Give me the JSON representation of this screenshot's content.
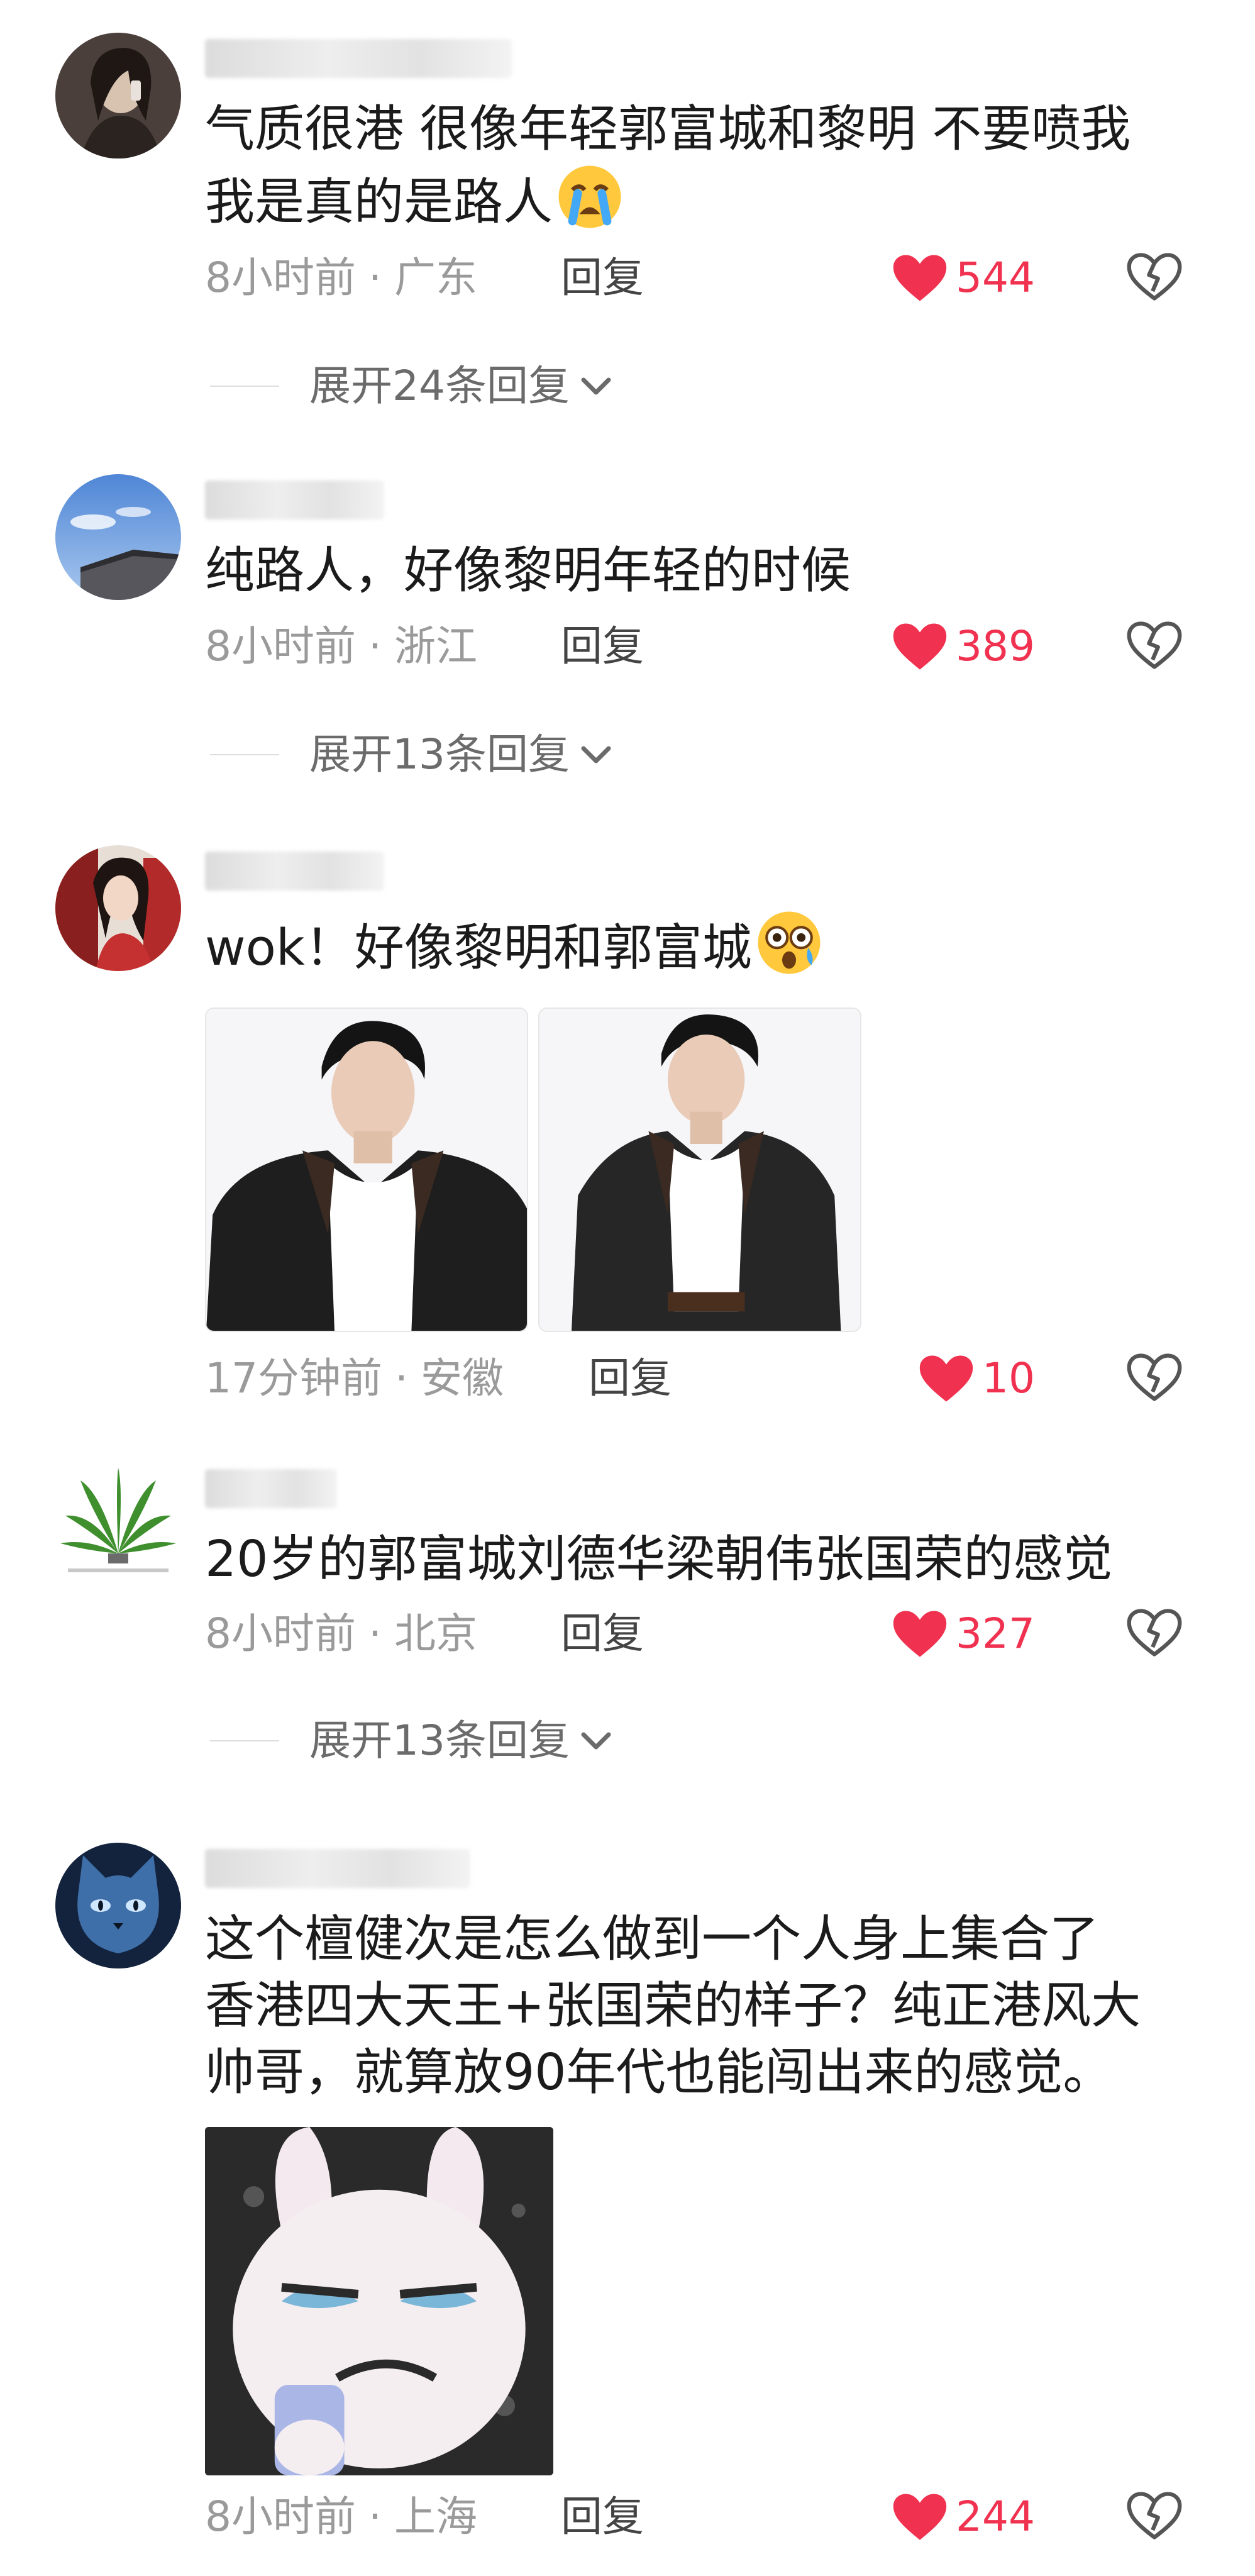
{
  "comments": [
    {
      "text": "气质很港 很像年轻郭富城和黎明 不要喷我\n我是真的是路人",
      "time": "8小时前",
      "location": "广东",
      "reply_label": "回复",
      "likes": "544",
      "expand_label": "展开24条回复"
    },
    {
      "text": "纯路人，好像黎明年轻的时候",
      "time": "8小时前",
      "location": "浙江",
      "reply_label": "回复",
      "likes": "389",
      "expand_label": "展开13条回复"
    },
    {
      "text": "wok！好像黎明和郭富城",
      "time": "17分钟前",
      "location": "安徽",
      "reply_label": "回复",
      "likes": "10"
    },
    {
      "text": "20岁的郭富城刘德华梁朝伟张国荣的感觉",
      "time": "8小时前",
      "location": "北京",
      "reply_label": "回复",
      "likes": "327",
      "expand_label": "展开13条回复"
    },
    {
      "text": "这个檀健次是怎么做到一个人身上集合了\n香港四大天王+张国荣的样子？纯正港风大\n帅哥，就算放90年代也能闯出来的感觉。",
      "time": "8小时前",
      "location": "上海",
      "reply_label": "回复",
      "likes": "244"
    }
  ],
  "meta_separator": "·",
  "colors": {
    "like": "#f0314f",
    "meta": "#9a9a9a",
    "text": "#1b1b1b"
  },
  "icons": {
    "like": "heart-icon",
    "dislike": "broken-heart-icon",
    "expand": "chevron-down-icon",
    "crying_emoji": "crying-face-emoji",
    "shocked_emoji": "astonished-face-emoji"
  }
}
